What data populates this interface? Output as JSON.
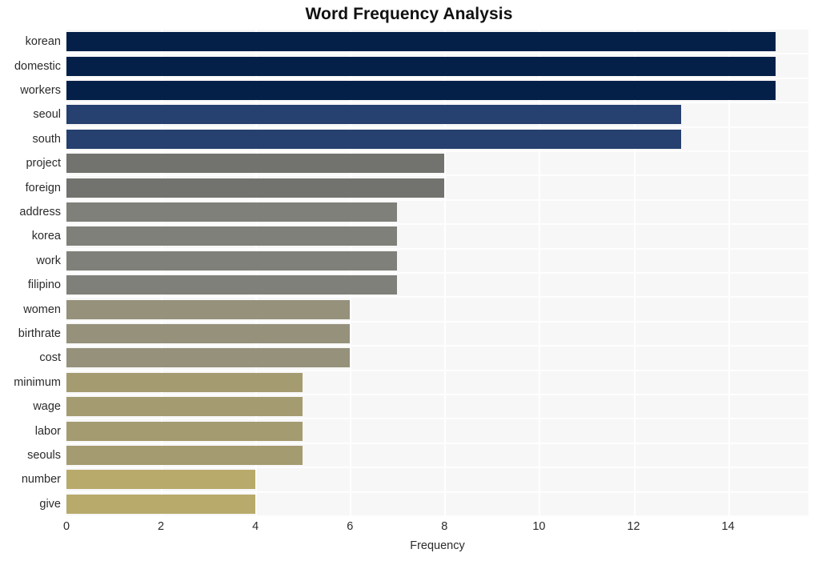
{
  "chart_data": {
    "type": "bar",
    "orientation": "horizontal",
    "title": "Word Frequency Analysis",
    "xlabel": "Frequency",
    "ylabel": "",
    "categories": [
      "korean",
      "domestic",
      "workers",
      "seoul",
      "south",
      "project",
      "foreign",
      "address",
      "korea",
      "work",
      "filipino",
      "women",
      "birthrate",
      "cost",
      "minimum",
      "wage",
      "labor",
      "seouls",
      "number",
      "give"
    ],
    "values": [
      15,
      15,
      15,
      13,
      13,
      8,
      8,
      7,
      7,
      7,
      7,
      6,
      6,
      6,
      5,
      5,
      5,
      5,
      4,
      4
    ],
    "bar_colors": [
      "#042048",
      "#042048",
      "#042048",
      "#26406f",
      "#26406f",
      "#72726f",
      "#72726f",
      "#80807a",
      "#80807a",
      "#80807a",
      "#80807a",
      "#95917b",
      "#95917b",
      "#95917b",
      "#a59b70",
      "#a59b70",
      "#a59b70",
      "#a59b70",
      "#b8aa6b",
      "#b8aa6b"
    ],
    "xlim": [
      0,
      15.7
    ],
    "xticks": [
      0,
      2,
      4,
      6,
      8,
      10,
      12,
      14
    ],
    "xtick_labels": [
      "0",
      "2",
      "4",
      "6",
      "8",
      "10",
      "12",
      "14"
    ],
    "grid": true,
    "grid_color": "#ffffff",
    "plot_background": "#f7f7f7",
    "figure_background": "#ffffff",
    "legend": null
  }
}
